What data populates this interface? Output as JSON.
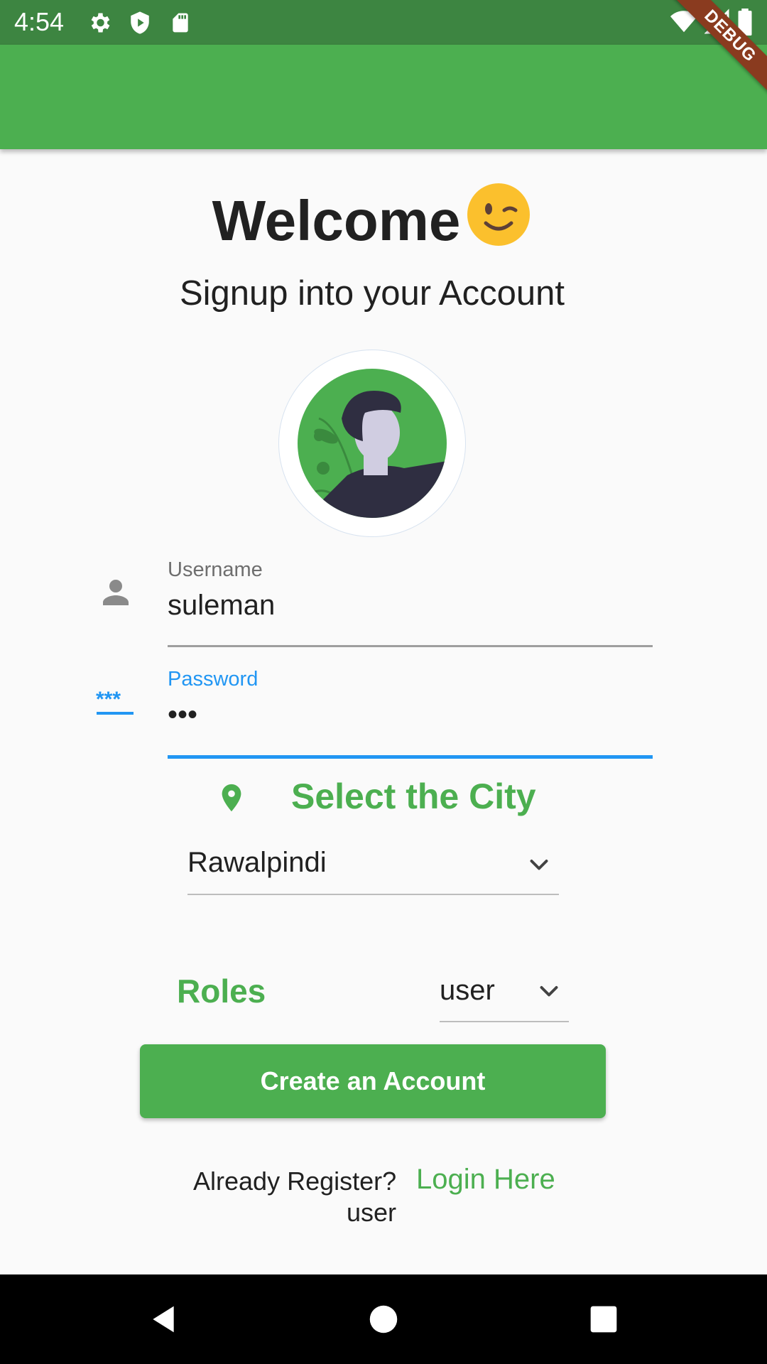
{
  "status_bar": {
    "time": "4:54",
    "icons": [
      "gear-icon",
      "shield-icon",
      "sd-card-icon",
      "wifi-icon",
      "signal-icon",
      "battery-icon"
    ]
  },
  "debug_banner": "DEBUG",
  "header": {
    "welcome": "Welcome",
    "emoji": "winking-face",
    "subtitle": "Signup into your Account"
  },
  "form": {
    "username": {
      "label": "Username",
      "value": "suleman",
      "icon": "person-icon"
    },
    "password": {
      "label": "Password",
      "value": "•••",
      "icon": "password-icon"
    },
    "city": {
      "title": "Select the City",
      "icon": "location-pin-icon",
      "selected": "Rawalpindi"
    },
    "roles": {
      "label": "Roles",
      "selected": "user"
    }
  },
  "actions": {
    "create_account": "Create an Account",
    "already_registered": "Already Register?",
    "login_link": "Login Here",
    "role_echo": "user"
  },
  "colors": {
    "primary": "#4caf50",
    "status_bar": "#3d8541",
    "focus": "#2196f3",
    "text": "#212121",
    "background": "#fafafa"
  }
}
